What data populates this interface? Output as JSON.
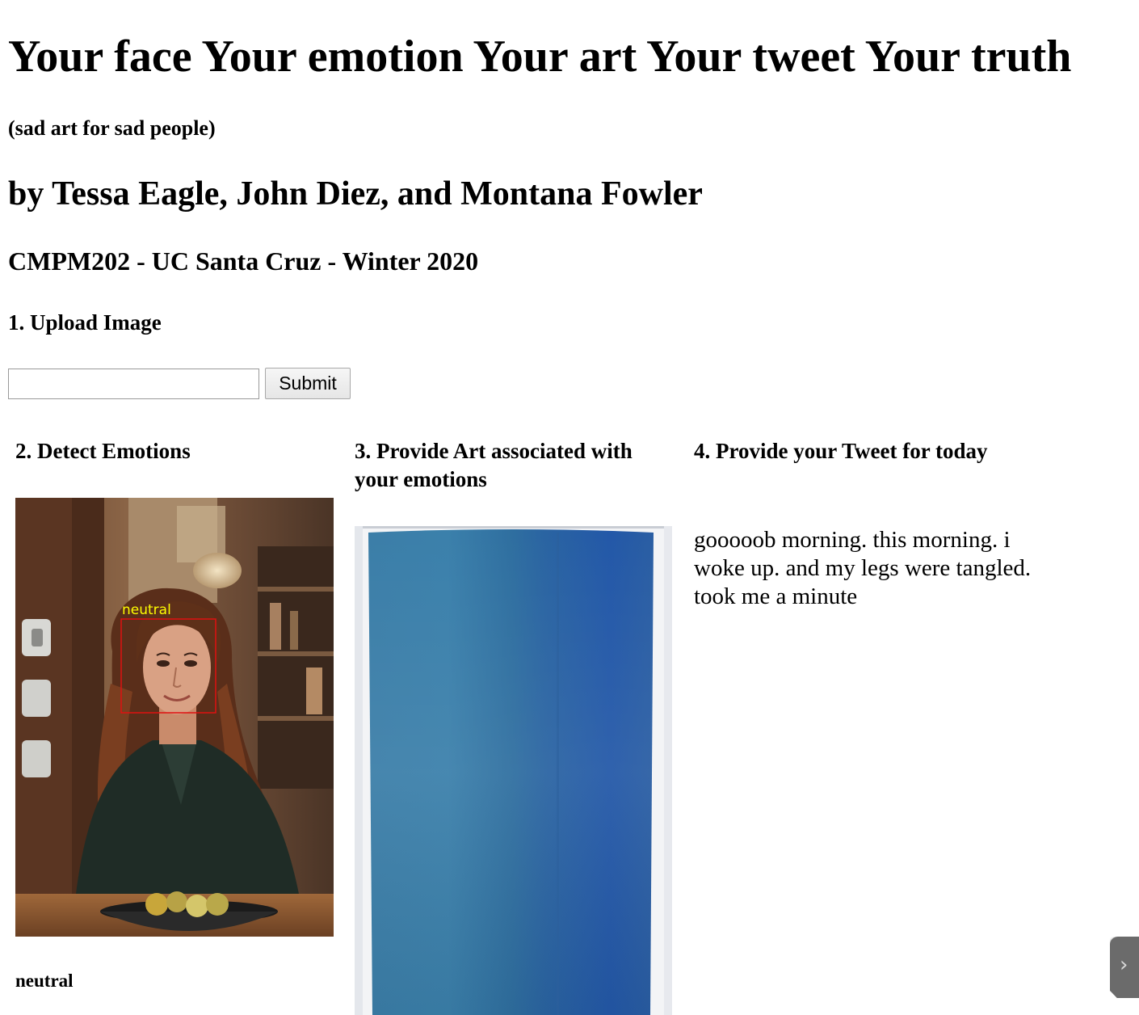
{
  "header": {
    "title": "Your face Your emotion Your art Your tweet Your truth",
    "subtitle": "(sad art for sad people)",
    "authors": "by Tessa Eagle, John Diez, and Montana Fowler",
    "course": "CMPM202 - UC Santa Cruz - Winter 2020"
  },
  "upload": {
    "heading": "1. Upload Image",
    "input_value": "",
    "submit_label": "Submit"
  },
  "detect": {
    "heading": "2. Detect Emotions",
    "face_label": "neutral",
    "result": "neutral"
  },
  "art": {
    "heading": "3. Provide Art associated with your emotions"
  },
  "tweet": {
    "heading": "4. Provide your Tweet for today",
    "text": "gooooob morning. this morning. i woke up. and my legs were tangled. took me a minute"
  },
  "side_tab": {
    "icon": "chevron-right-icon"
  },
  "colors": {
    "face_box": "#e01010",
    "face_label": "#ffff00",
    "art_blue_light": "#2f74a4",
    "art_blue_dark": "#1e4f9e"
  }
}
